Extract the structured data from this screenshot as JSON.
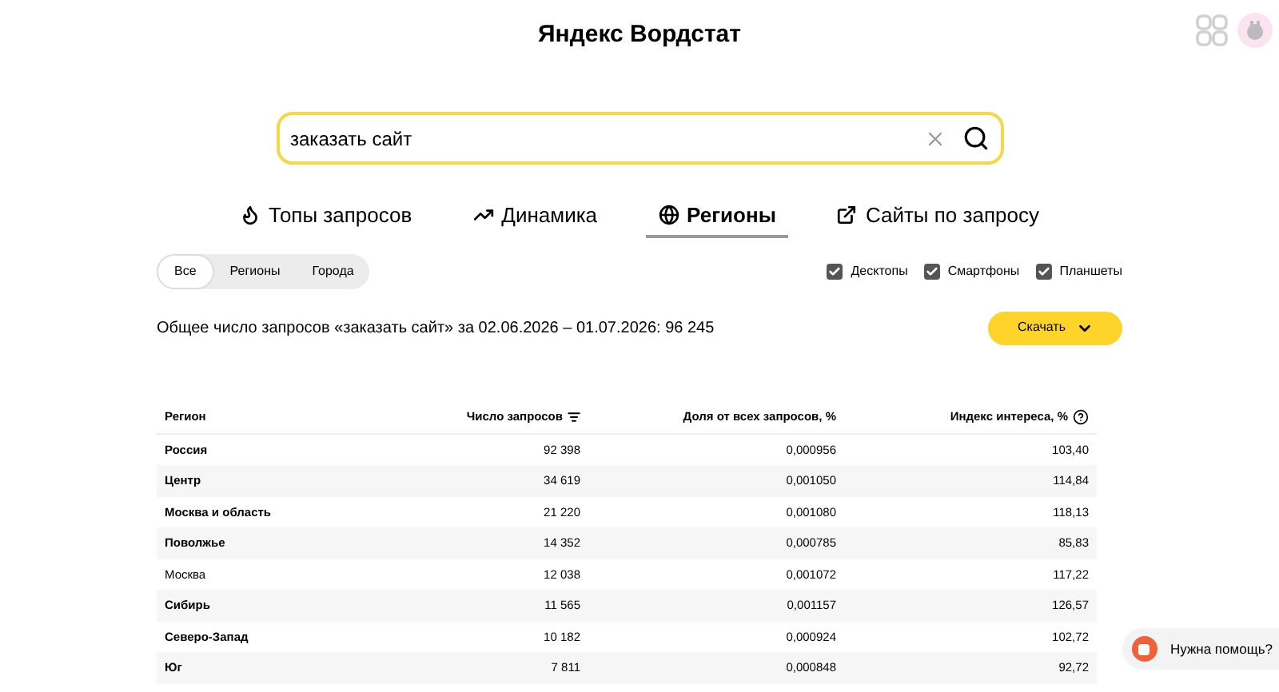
{
  "header": {
    "title": "Яндекс Вордстат"
  },
  "search": {
    "value": "заказать сайт"
  },
  "tabs": [
    {
      "label": "Топы запросов",
      "selected": false
    },
    {
      "label": "Динамика",
      "selected": false
    },
    {
      "label": "Регионы",
      "selected": true
    },
    {
      "label": "Сайты по запросу",
      "selected": false
    }
  ],
  "segments": [
    {
      "label": "Все",
      "selected": true
    },
    {
      "label": "Регионы",
      "selected": false
    },
    {
      "label": "Города",
      "selected": false
    }
  ],
  "devices": [
    {
      "label": "Десктопы",
      "checked": true
    },
    {
      "label": "Смартфоны",
      "checked": true
    },
    {
      "label": "Планшеты",
      "checked": true
    }
  ],
  "summary": "Общее число запросов «заказать сайт» за 02.06.2026 – 01.07.2026: 96 245",
  "download_button": "Скачать",
  "table": {
    "columns": [
      "Регион",
      "Число запросов",
      "Доля от всех запросов, %",
      "Индекс интереса, %"
    ],
    "rows": [
      {
        "kind": "region",
        "cells": [
          "Россия",
          "92 398",
          "0,000956",
          "103,40"
        ]
      },
      {
        "kind": "region",
        "cells": [
          "Центр",
          "34 619",
          "0,001050",
          "114,84"
        ]
      },
      {
        "kind": "region",
        "cells": [
          "Москва и область",
          "21 220",
          "0,001080",
          "118,13"
        ]
      },
      {
        "kind": "region",
        "cells": [
          "Поволжье",
          "14 352",
          "0,000785",
          "85,83"
        ]
      },
      {
        "kind": "city",
        "cells": [
          "Москва",
          "12 038",
          "0,001072",
          "117,22"
        ]
      },
      {
        "kind": "region",
        "cells": [
          "Сибирь",
          "11 565",
          "0,001157",
          "126,57"
        ]
      },
      {
        "kind": "region",
        "cells": [
          "Северо-Запад",
          "10 182",
          "0,000924",
          "102,72"
        ]
      },
      {
        "kind": "region",
        "cells": [
          "Юг",
          "7 811",
          "0,000848",
          "92,72"
        ]
      }
    ]
  },
  "help_button": "Нужна помощь?"
}
